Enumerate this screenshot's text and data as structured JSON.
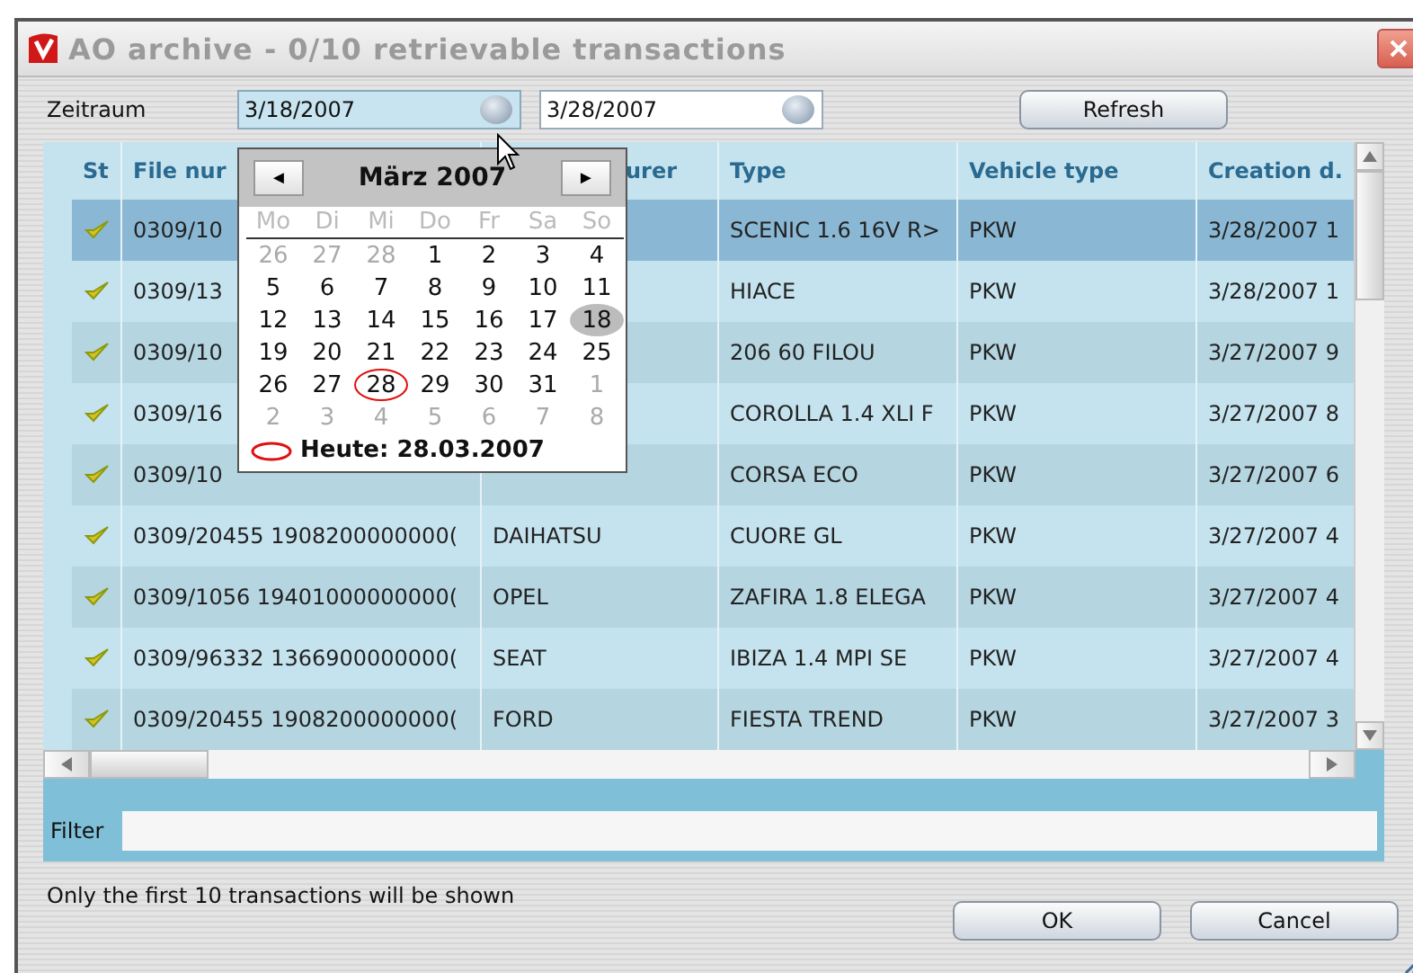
{
  "window": {
    "title": "AO archive -  0/10 retrievable transactions"
  },
  "period": {
    "label": "Zeitraum",
    "from": "3/18/2007",
    "to": "3/28/2007",
    "from_focused": true
  },
  "refresh_button": "Refresh",
  "table": {
    "columns": [
      "St",
      "File nur",
      "urer",
      "Type",
      "Vehicle type",
      "Creation d."
    ],
    "rows": [
      {
        "selected": true,
        "cells": [
          "",
          "0309/10",
          "",
          "SCENIC 1.6 16V R>",
          "PKW",
          "3/28/2007 1"
        ]
      },
      {
        "selected": false,
        "cells": [
          "",
          "0309/13",
          "",
          "HIACE",
          "PKW",
          "3/28/2007 1"
        ]
      },
      {
        "selected": false,
        "cells": [
          "",
          "0309/10",
          "",
          "206 60 FILOU",
          "PKW",
          "3/27/2007 9"
        ]
      },
      {
        "selected": false,
        "cells": [
          "",
          "0309/16",
          "",
          "COROLLA 1.4 XLI F",
          "PKW",
          "3/27/2007 8"
        ]
      },
      {
        "selected": false,
        "cells": [
          "",
          "0309/10",
          "",
          "CORSA ECO",
          "PKW",
          "3/27/2007 6"
        ]
      },
      {
        "selected": false,
        "cells": [
          "",
          "0309/20455 1908200000000(",
          "DAIHATSU",
          "CUORE GL",
          "PKW",
          "3/27/2007 4"
        ]
      },
      {
        "selected": false,
        "cells": [
          "",
          "0309/1056 19401000000000(",
          "OPEL",
          "ZAFIRA 1.8 ELEGA",
          "PKW",
          "3/27/2007 4"
        ]
      },
      {
        "selected": false,
        "cells": [
          "",
          "0309/96332 1366900000000(",
          "SEAT",
          "IBIZA 1.4 MPI SE",
          "PKW",
          "3/27/2007 4"
        ]
      },
      {
        "selected": false,
        "cells": [
          "",
          "0309/20455 1908200000000(",
          "FORD",
          "FIESTA TREND",
          "PKW",
          "3/27/2007 3"
        ]
      }
    ]
  },
  "calendar": {
    "prev": "◄",
    "month": "März 2007",
    "next": "►",
    "weekdays": [
      "Mo",
      "Di",
      "Mi",
      "Do",
      "Fr",
      "Sa",
      "So"
    ],
    "weeks": [
      [
        {
          "day": "26",
          "other_month": true,
          "selected": false,
          "today": false
        },
        {
          "day": "27",
          "other_month": true,
          "selected": false,
          "today": false
        },
        {
          "day": "28",
          "other_month": true,
          "selected": false,
          "today": false
        },
        {
          "day": "1",
          "other_month": false,
          "selected": false,
          "today": false
        },
        {
          "day": "2",
          "other_month": false,
          "selected": false,
          "today": false
        },
        {
          "day": "3",
          "other_month": false,
          "selected": false,
          "today": false
        },
        {
          "day": "4",
          "other_month": false,
          "selected": false,
          "today": false
        }
      ],
      [
        {
          "day": "5",
          "other_month": false,
          "selected": false,
          "today": false
        },
        {
          "day": "6",
          "other_month": false,
          "selected": false,
          "today": false
        },
        {
          "day": "7",
          "other_month": false,
          "selected": false,
          "today": false
        },
        {
          "day": "8",
          "other_month": false,
          "selected": false,
          "today": false
        },
        {
          "day": "9",
          "other_month": false,
          "selected": false,
          "today": false
        },
        {
          "day": "10",
          "other_month": false,
          "selected": false,
          "today": false
        },
        {
          "day": "11",
          "other_month": false,
          "selected": false,
          "today": false
        }
      ],
      [
        {
          "day": "12",
          "other_month": false,
          "selected": false,
          "today": false
        },
        {
          "day": "13",
          "other_month": false,
          "selected": false,
          "today": false
        },
        {
          "day": "14",
          "other_month": false,
          "selected": false,
          "today": false
        },
        {
          "day": "15",
          "other_month": false,
          "selected": false,
          "today": false
        },
        {
          "day": "16",
          "other_month": false,
          "selected": false,
          "today": false
        },
        {
          "day": "17",
          "other_month": false,
          "selected": false,
          "today": false
        },
        {
          "day": "18",
          "other_month": false,
          "selected": true,
          "today": false
        }
      ],
      [
        {
          "day": "19",
          "other_month": false,
          "selected": false,
          "today": false
        },
        {
          "day": "20",
          "other_month": false,
          "selected": false,
          "today": false
        },
        {
          "day": "21",
          "other_month": false,
          "selected": false,
          "today": false
        },
        {
          "day": "22",
          "other_month": false,
          "selected": false,
          "today": false
        },
        {
          "day": "23",
          "other_month": false,
          "selected": false,
          "today": false
        },
        {
          "day": "24",
          "other_month": false,
          "selected": false,
          "today": false
        },
        {
          "day": "25",
          "other_month": false,
          "selected": false,
          "today": false
        }
      ],
      [
        {
          "day": "26",
          "other_month": false,
          "selected": false,
          "today": false
        },
        {
          "day": "27",
          "other_month": false,
          "selected": false,
          "today": false
        },
        {
          "day": "28",
          "other_month": false,
          "selected": false,
          "today": true
        },
        {
          "day": "29",
          "other_month": false,
          "selected": false,
          "today": false
        },
        {
          "day": "30",
          "other_month": false,
          "selected": false,
          "today": false
        },
        {
          "day": "31",
          "other_month": false,
          "selected": false,
          "today": false
        },
        {
          "day": "1",
          "other_month": true,
          "selected": false,
          "today": false
        }
      ],
      [
        {
          "day": "2",
          "other_month": true,
          "selected": false,
          "today": false
        },
        {
          "day": "3",
          "other_month": true,
          "selected": false,
          "today": false
        },
        {
          "day": "4",
          "other_month": true,
          "selected": false,
          "today": false
        },
        {
          "day": "5",
          "other_month": true,
          "selected": false,
          "today": false
        },
        {
          "day": "6",
          "other_month": true,
          "selected": false,
          "today": false
        },
        {
          "day": "7",
          "other_month": true,
          "selected": false,
          "today": false
        },
        {
          "day": "8",
          "other_month": true,
          "selected": false,
          "today": false
        }
      ]
    ],
    "today_label": "Heute: 28.03.2007"
  },
  "filter": {
    "label": "Filter"
  },
  "note": "Only the first 10 transactions will be shown",
  "buttons": [
    "OK",
    "Cancel"
  ]
}
